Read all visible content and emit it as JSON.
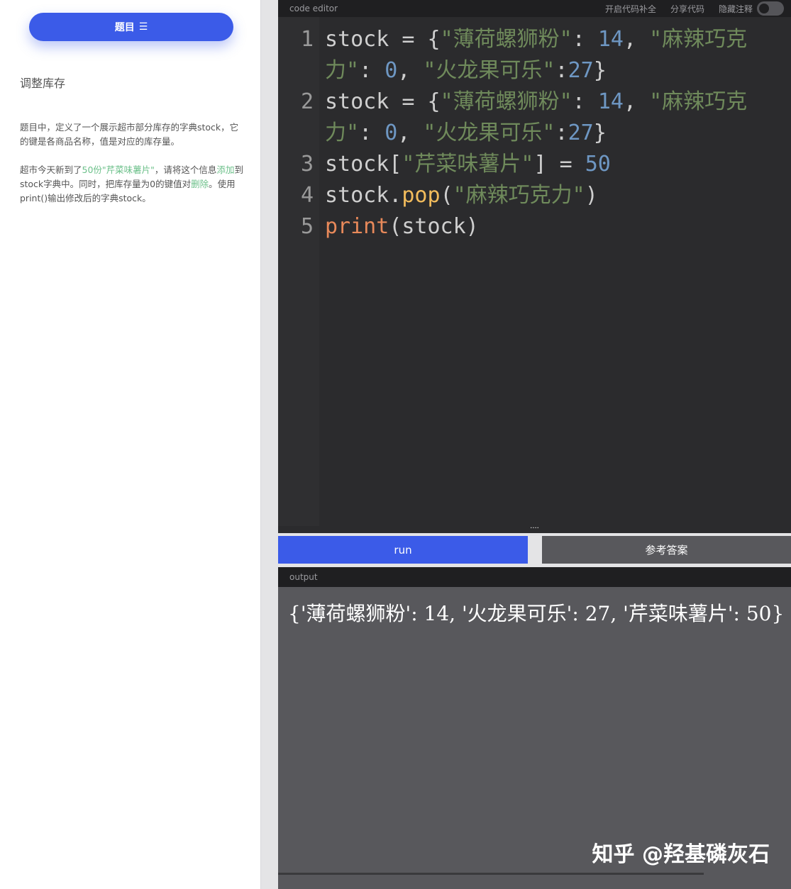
{
  "sidebar": {
    "topic_button_label": "题目",
    "topic_button_icon": "☰",
    "lesson_title": "调整库存",
    "desc1": "题目中，定义了一个展示超市部分库存的字典stock，它的键是各商品名称，值是对应的库存量。",
    "desc2": {
      "a": "超市今天新到了",
      "b": "50份\"芹菜味薯片\"",
      "c": "，请将这个信息",
      "d": "添加",
      "e": "到stock字典中。同时，把库存量为0的键值对",
      "f": "删除",
      "g": "。使用print()输出修改后的字典stock。"
    },
    "highlight_color": "#6cc08a"
  },
  "editor": {
    "title": "code editor",
    "tool_autocomplete": "开启代码补全",
    "tool_share": "分享代码",
    "tool_hide_comments": "隐藏注释",
    "lines": [
      {
        "n": "1",
        "parts": [
          [
            "p",
            "stock = {"
          ],
          [
            "s",
            "\"薄荷螺狮粉\""
          ],
          [
            "p",
            ": "
          ],
          [
            "n",
            "14"
          ],
          [
            "p",
            ", "
          ],
          [
            "s",
            "\"麻辣巧克力\""
          ],
          [
            "p",
            ": "
          ],
          [
            "n",
            "0"
          ],
          [
            "p",
            ", "
          ],
          [
            "s",
            "\"火龙果可乐\""
          ],
          [
            "p",
            ":"
          ],
          [
            "n",
            "27"
          ],
          [
            "p",
            "}"
          ]
        ]
      },
      {
        "n": "2",
        "parts": [
          [
            "p",
            "stock = {"
          ],
          [
            "s",
            "\"薄荷螺狮粉\""
          ],
          [
            "p",
            ": "
          ],
          [
            "n",
            "14"
          ],
          [
            "p",
            ", "
          ],
          [
            "s",
            "\"麻辣巧克力\""
          ],
          [
            "p",
            ": "
          ],
          [
            "n",
            "0"
          ],
          [
            "p",
            ", "
          ],
          [
            "s",
            "\"火龙果可乐\""
          ],
          [
            "p",
            ":"
          ],
          [
            "n",
            "27"
          ],
          [
            "p",
            "}"
          ]
        ]
      },
      {
        "n": "3",
        "parts": [
          [
            "p",
            "stock["
          ],
          [
            "s",
            "\"芹菜味薯片\""
          ],
          [
            "p",
            "] = "
          ],
          [
            "n",
            "50"
          ]
        ]
      },
      {
        "n": "4",
        "parts": [
          [
            "p",
            "stock."
          ],
          [
            "f",
            "pop"
          ],
          [
            "p",
            "("
          ],
          [
            "s",
            "\"麻辣巧克力\""
          ],
          [
            "p",
            ")"
          ]
        ]
      },
      {
        "n": "5",
        "parts": [
          [
            "k",
            "print"
          ],
          [
            "p",
            "(stock)"
          ]
        ]
      }
    ]
  },
  "actions": {
    "run_label": "run",
    "answer_label": "参考答案"
  },
  "output": {
    "title": "output",
    "text": "{'薄荷螺狮粉': 14, '火龙果可乐': 27, '芹菜味薯片': 50}",
    "watermark": "知乎 @羟基磷灰石"
  },
  "colors": {
    "accent": "#3b5be8",
    "editor_bg": "#2b2b2d",
    "output_bg": "#58585c",
    "string": "#6f8a5b",
    "number": "#6e97c3"
  }
}
